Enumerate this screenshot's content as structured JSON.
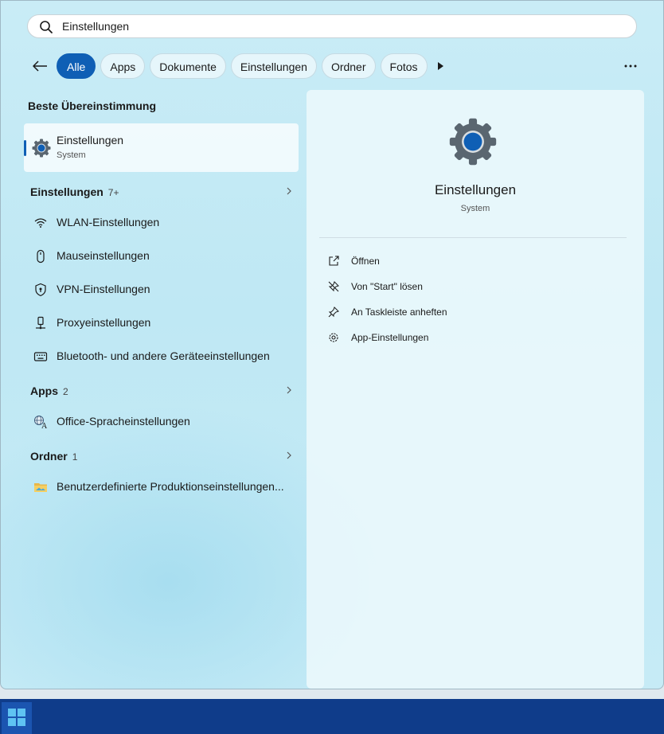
{
  "search": {
    "value": "Einstellungen"
  },
  "filters": {
    "chips": [
      "Alle",
      "Apps",
      "Dokumente",
      "Einstellungen",
      "Ordner",
      "Fotos"
    ],
    "active": "Alle"
  },
  "best_match": {
    "heading": "Beste Übereinstimmung",
    "title": "Einstellungen",
    "subtitle": "System"
  },
  "settings_section": {
    "title": "Einstellungen",
    "count": "7+",
    "items": [
      {
        "label": "WLAN-Einstellungen",
        "icon": "wifi-icon"
      },
      {
        "label": "Mauseinstellungen",
        "icon": "mouse-icon"
      },
      {
        "label": "VPN-Einstellungen",
        "icon": "shield-icon"
      },
      {
        "label": "Proxyeinstellungen",
        "icon": "proxy-icon"
      },
      {
        "label": "Bluetooth- und andere Geräteeinstellungen",
        "icon": "keyboard-icon"
      }
    ]
  },
  "apps_section": {
    "title": "Apps",
    "count": "2",
    "items": [
      {
        "label": "Office-Spracheinstellungen",
        "icon": "language-icon"
      }
    ]
  },
  "folders_section": {
    "title": "Ordner",
    "count": "1",
    "items": [
      {
        "label": "Benutzerdefinierte Produktionseinstellungen...",
        "icon": "folder-icon"
      }
    ]
  },
  "detail": {
    "title": "Einstellungen",
    "subtitle": "System",
    "actions": [
      {
        "label": "Öffnen",
        "icon": "open-icon"
      },
      {
        "label": "Von \"Start\" lösen",
        "icon": "unpin-icon"
      },
      {
        "label": "An Taskleiste anheften",
        "icon": "pin-icon"
      },
      {
        "label": "App-Einstellungen",
        "icon": "gear-icon"
      }
    ]
  },
  "colors": {
    "accent": "#0f5fb5",
    "taskbar": "#0f3c8a"
  }
}
